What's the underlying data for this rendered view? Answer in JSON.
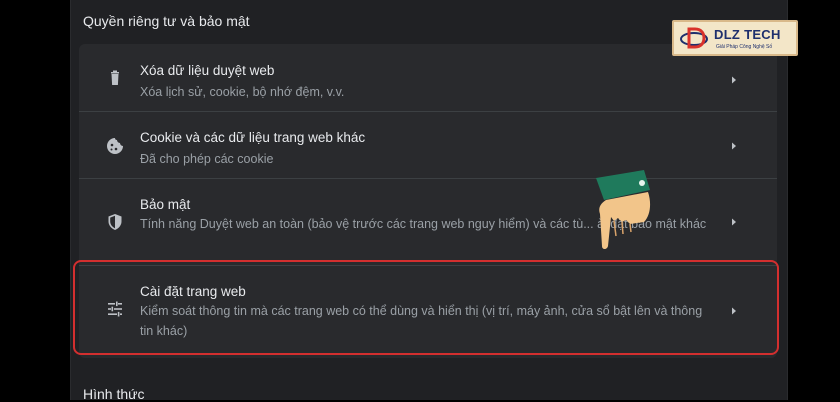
{
  "section": {
    "title": "Quyền riêng tư và bảo mật"
  },
  "rows": [
    {
      "icon": "trash-icon",
      "title": "Xóa dữ liệu duyệt web",
      "desc": "Xóa lịch sử, cookie, bộ nhớ đệm, v.v."
    },
    {
      "icon": "cookie-icon",
      "title": "Cookie và các dữ liệu trang web khác",
      "desc": "Đã cho phép các cookie"
    },
    {
      "icon": "shield-icon",
      "title": "Bảo mật",
      "desc": "Tính năng Duyệt web an toàn (bảo vệ trước các trang web nguy hiểm) và các tù... ài đặt bảo mật khác"
    },
    {
      "icon": "tune-sliders-icon",
      "title": "Cài đặt trang web",
      "desc": "Kiểm soát thông tin mà các trang web có thể dùng và hiển thị (vị trí, máy ảnh, cửa sổ bật lên và thông tin khác)"
    }
  ],
  "next_section": {
    "title": "Hình thức"
  },
  "watermark": {
    "brand": "DLZ TECH",
    "tagline": "Giải Pháp Công Nghệ Số"
  },
  "colors": {
    "highlight": "#d32f2f",
    "panel_bg": "#202124",
    "card_bg": "#292a2d"
  }
}
